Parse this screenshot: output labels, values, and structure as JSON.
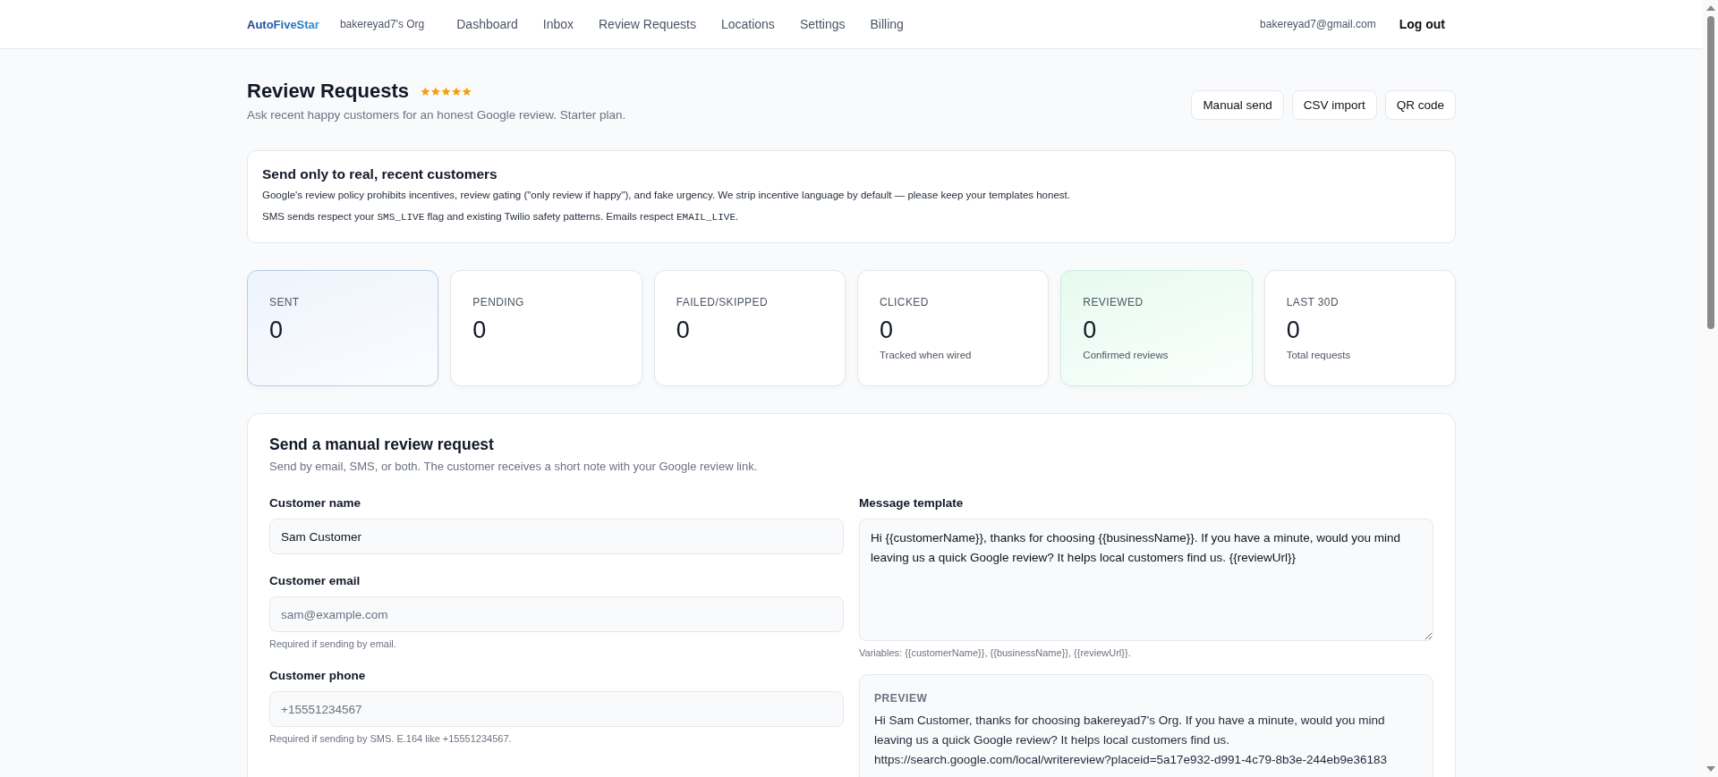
{
  "header": {
    "logo": "AutoFiveStar",
    "org": "bakereyad7's Org",
    "nav": [
      "Dashboard",
      "Inbox",
      "Review Requests",
      "Locations",
      "Settings",
      "Billing"
    ],
    "email": "bakereyad7@gmail.com",
    "logout": "Log out"
  },
  "page": {
    "title": "Review Requests",
    "stars": 5,
    "subtitle": "Ask recent happy customers for an honest Google review. Starter plan.",
    "actions": [
      "Manual send",
      "CSV import",
      "QR code"
    ]
  },
  "notice": {
    "title": "Send only to real, recent customers",
    "paragraphs": [
      [
        {
          "kind": "text",
          "text": "Google's review policy prohibits incentives, review gating (\"only review if happy\"), and fake urgency. We strip incentive language by default — please keep your templates honest."
        }
      ],
      [
        {
          "kind": "text",
          "text": "SMS sends respect your "
        },
        {
          "kind": "code",
          "text": "SMS_LIVE"
        },
        {
          "kind": "text",
          "text": " flag and existing Twilio safety patterns. Emails respect "
        },
        {
          "kind": "code",
          "text": "EMAIL_LIVE"
        },
        {
          "kind": "text",
          "text": "."
        }
      ]
    ]
  },
  "stats": [
    {
      "label": "SENT",
      "value": "0",
      "kind": "accent"
    },
    {
      "label": "PENDING",
      "value": "0",
      "kind": "plain"
    },
    {
      "label": "FAILED/SKIPPED",
      "value": "0",
      "kind": "plain"
    },
    {
      "label": "CLICKED",
      "value": "0",
      "note": "Tracked when wired",
      "kind": "plain"
    },
    {
      "label": "REVIEWED",
      "value": "0",
      "note": "Confirmed reviews",
      "kind": "success"
    },
    {
      "label": "LAST 30D",
      "value": "0",
      "note": "Total requests",
      "kind": "plain"
    }
  ],
  "form": {
    "title": "Send a manual review request",
    "subtitle": "Send by email, SMS, or both. The customer receives a short note with your Google review link.",
    "fields": [
      {
        "label": "Customer name",
        "value": "Sam Customer"
      },
      {
        "label": "Customer email",
        "placeholder": "sam@example.com",
        "help": "Required if sending by email."
      },
      {
        "label": "Customer phone",
        "placeholder": "+15551234567",
        "help": "Required if sending by SMS. E.164 like +15551234567."
      }
    ],
    "template": {
      "label": "Message template",
      "value": "Hi {{customerName}}, thanks for choosing {{businessName}}. If you have a minute, would you mind leaving us a quick Google review? It helps local customers find us. {{reviewUrl}}",
      "help": "Variables: {{customerName}}, {{businessName}}, {{reviewUrl}}."
    },
    "preview": {
      "label": "PREVIEW",
      "text": "Hi Sam Customer, thanks for choosing bakereyad7's Org. If you have a minute, would you mind leaving us a quick Google review? It helps local customers find us. https://search.google.com/local/writereview?placeid=5a17e932-d991-4c79-8b3e-244eb9e36183"
    }
  }
}
